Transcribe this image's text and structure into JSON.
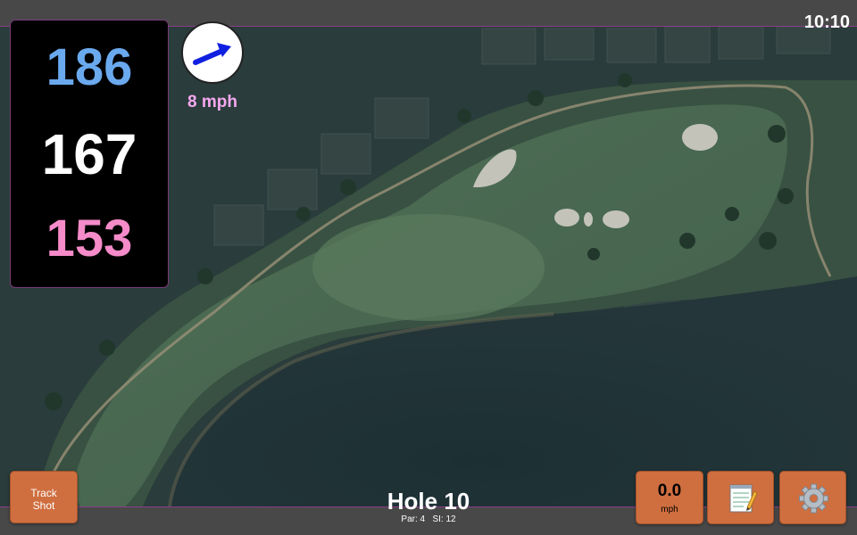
{
  "status": {
    "time": "10:10"
  },
  "distances": {
    "back": "186",
    "middle": "167",
    "front": "153"
  },
  "wind": {
    "speed_label": "8 mph",
    "icon": "wind-arrow-icon",
    "arrow_color": "#1020e0"
  },
  "buttons": {
    "track_shot_line1": "Track",
    "track_shot_line2": "Shot",
    "speed_value": "0.0",
    "speed_unit": "mph",
    "notes_icon": "notepad-icon",
    "settings_icon": "gear-icon"
  },
  "hole": {
    "title": "Hole 10",
    "par_label": "Par: 4",
    "si_label": "SI: 12"
  },
  "colors": {
    "back_distance": "#6aa9ee",
    "middle_distance": "#ffffff",
    "front_distance": "#f58bc9",
    "wind_label": "#f5a8f0",
    "button_bg": "#cf6e3f",
    "accent_line": "#8a3c8a"
  }
}
